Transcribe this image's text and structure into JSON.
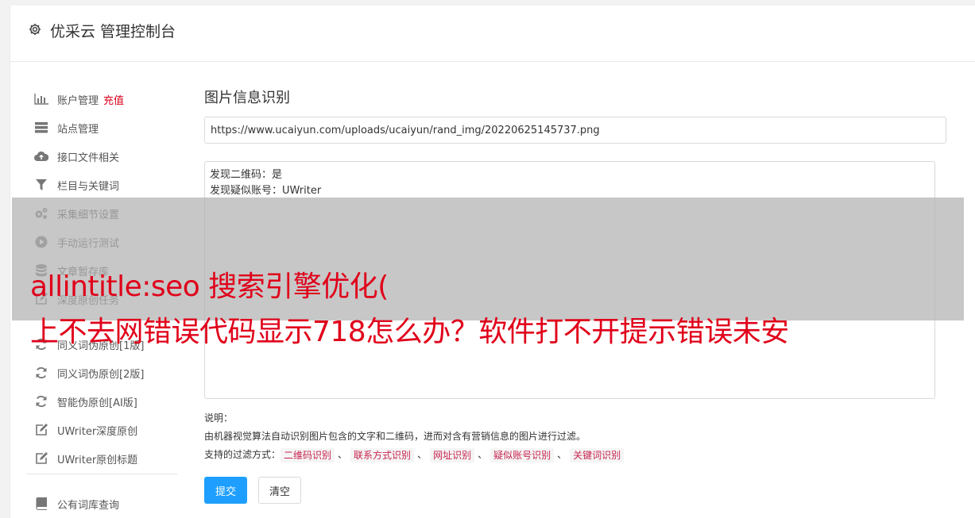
{
  "header": {
    "title": "优采云 管理控制台"
  },
  "sidebar": {
    "items": [
      {
        "label": "账户管理",
        "extra": "充值",
        "icon": "bar-chart-icon"
      },
      {
        "label": "站点管理",
        "icon": "server-icon"
      },
      {
        "label": "接口文件相关",
        "icon": "cloud-upload-icon"
      },
      {
        "label": "栏目与关键词",
        "icon": "filter-icon"
      },
      {
        "label": "采集细节设置",
        "icon": "gears-icon"
      },
      {
        "label": "手动运行测试",
        "icon": "play-circle-icon"
      },
      {
        "label": "文章暂存库",
        "icon": "database-icon"
      },
      {
        "label": "深度原创任务",
        "icon": "edit-icon"
      },
      {
        "label": "同义词伪原创[1版]",
        "icon": "refresh-icon"
      },
      {
        "label": "同义词伪原创[2版]",
        "icon": "refresh-icon"
      },
      {
        "label": "智能伪原创[AI版]",
        "icon": "refresh-icon"
      },
      {
        "label": "UWriter深度原创",
        "icon": "edit-icon"
      },
      {
        "label": "UWriter原创标题",
        "icon": "edit-icon"
      },
      {
        "label": "公有词库查询",
        "icon": "book-icon"
      }
    ]
  },
  "main": {
    "title": "图片信息识别",
    "url_value": "https://www.ucaiyun.com/uploads/ucaiyun/rand_img/20220625145737.png",
    "result_text": "发现二维码：是\n发现疑似账号：UWriter",
    "desc_label": "说明：",
    "desc_text": "由机器视觉算法自动识别图片包含的文字和二维码，进而对含有营销信息的图片进行过滤。",
    "filter_label": "支持的过滤方式：",
    "filter_tags": [
      "二维码识别",
      "联系方式识别",
      "网址识别",
      "疑似账号识别",
      "关键词识别"
    ],
    "separator": "、",
    "submit_label": "提交",
    "clear_label": "清空"
  },
  "overlay": {
    "line1": "allintitle:seo 搜索引擎优化(",
    "line2": "上不去网错误代码显示718怎么办？软件打不开提示错误未安"
  },
  "colors": {
    "accent": "#1e9fff",
    "danger": "#d9001b",
    "tag_text": "#c7254e"
  }
}
